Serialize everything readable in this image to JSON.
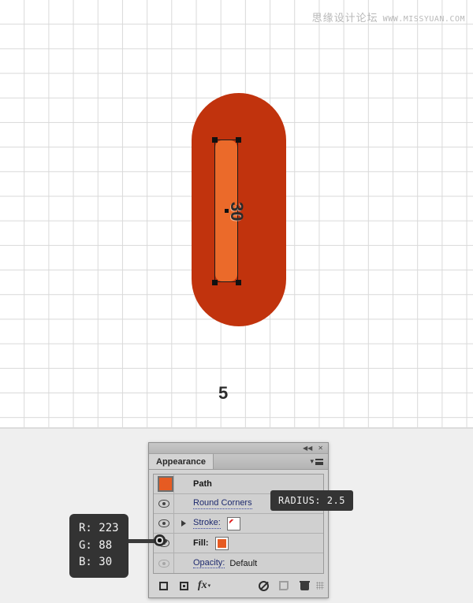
{
  "watermark": {
    "site_name": "思缘设计论坛",
    "url": "WWW.MISSYUAN.COM"
  },
  "canvas": {
    "artwork": {
      "outer_shape_color": "#c1330d",
      "inner_shape_color": "#eb6a2a",
      "dimension_height": "30",
      "dimension_width": "5"
    }
  },
  "panel": {
    "title": "Appearance",
    "collapse_label": "◀◀",
    "close_label": "✕",
    "rows": [
      {
        "name": "path",
        "label": "Path",
        "value": ""
      },
      {
        "name": "round-corners",
        "label": "Round Corners",
        "value": ""
      },
      {
        "name": "stroke",
        "label": "Stroke:",
        "value": ""
      },
      {
        "name": "fill",
        "label": "Fill:",
        "value": ""
      },
      {
        "name": "opacity",
        "label": "Opacity:",
        "value": "Default"
      }
    ],
    "footer": {
      "add_new_stroke": "Add New Stroke",
      "add_new_fill": "Add New Fill",
      "add_new_effect": "fx",
      "clear_appearance": "Clear Appearance",
      "duplicate_item": "Duplicate Selected Item",
      "delete_item": "Delete Selected Item",
      "resize_grip": "Resize"
    },
    "colors": {
      "fill_swatch": "#e65b22",
      "path_swatch": "#e65b22"
    }
  },
  "tooltips": {
    "radius": "RADIUS: 2.5",
    "rgb": {
      "r": "R: 223",
      "g": "G: 88",
      "b": "B: 30"
    }
  }
}
